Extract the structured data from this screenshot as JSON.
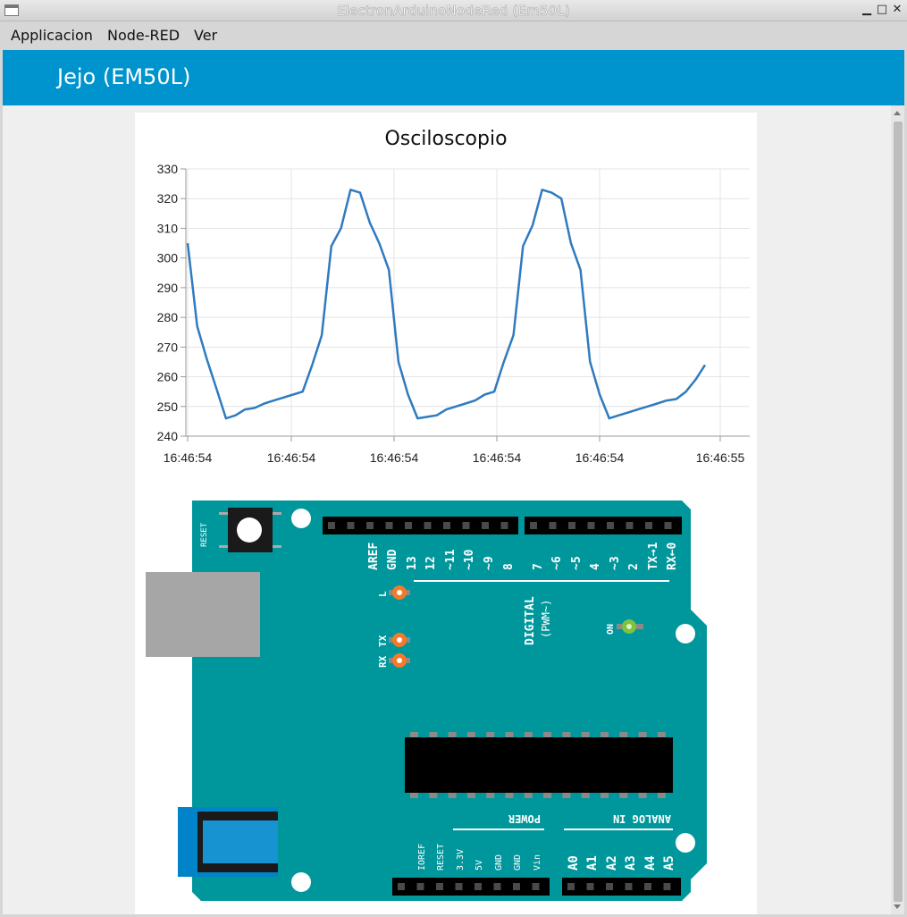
{
  "window": {
    "title": "ElectronArduinoNodeRed (Em50L)",
    "minimize_glyph": "▁",
    "maximize_glyph": "□",
    "close_glyph": "✕"
  },
  "menu": {
    "items": [
      "Applicacion",
      "Node-RED",
      "Ver"
    ]
  },
  "toolbar": {
    "title": "Jejo (EM50L)",
    "color": "#0094ce"
  },
  "chart_data": {
    "type": "line",
    "title": "Osciloscopio",
    "xlabel": "",
    "ylabel": "",
    "ylim": [
      240,
      330
    ],
    "yticks": [
      240,
      250,
      260,
      270,
      280,
      290,
      300,
      310,
      320,
      330
    ],
    "xtick_labels": [
      "16:46:54",
      "16:46:54",
      "16:46:54",
      "16:46:54",
      "16:46:54",
      "16:46:55"
    ],
    "grid": true,
    "line_color": "#2f7bbf",
    "series": [
      {
        "values": [
          305,
          277,
          266,
          256,
          246,
          247,
          249,
          249.5,
          251,
          252,
          253,
          254,
          255,
          264,
          274,
          304,
          310,
          323,
          322,
          312,
          305,
          296,
          265,
          254,
          246,
          246.5,
          247,
          249,
          250,
          251,
          252,
          254,
          255,
          265,
          274,
          304,
          311,
          323,
          322,
          320,
          305,
          296,
          265,
          254,
          246,
          247,
          248,
          249,
          250,
          251,
          252,
          252.5,
          255,
          259,
          264
        ]
      }
    ]
  },
  "board": {
    "reset_label": "RESET",
    "digital_pin_labels": [
      "AREF",
      "GND",
      "13",
      "12",
      "~11",
      "~10",
      "~9",
      "8",
      "7",
      "~6",
      "~5",
      "4",
      "~3",
      "2",
      "TX→1",
      "RX←0"
    ],
    "led_labels": [
      "L",
      "TX",
      "RX"
    ],
    "on_label": "ON",
    "digital_label": "DIGITAL",
    "pwm_label": "(PWM~)",
    "power_label": "POWER",
    "analog_label": "ANALOG IN",
    "power_pin_labels": [
      "IOREF",
      "RESET",
      "3.3V",
      "5V",
      "GND",
      "GND",
      "Vin"
    ],
    "analog_pin_labels": [
      "A0",
      "A1",
      "A2",
      "A3",
      "A4",
      "A5"
    ],
    "board_color": "#00979c",
    "led_orange": "#f47a2a",
    "led_green": "#7fc241"
  }
}
